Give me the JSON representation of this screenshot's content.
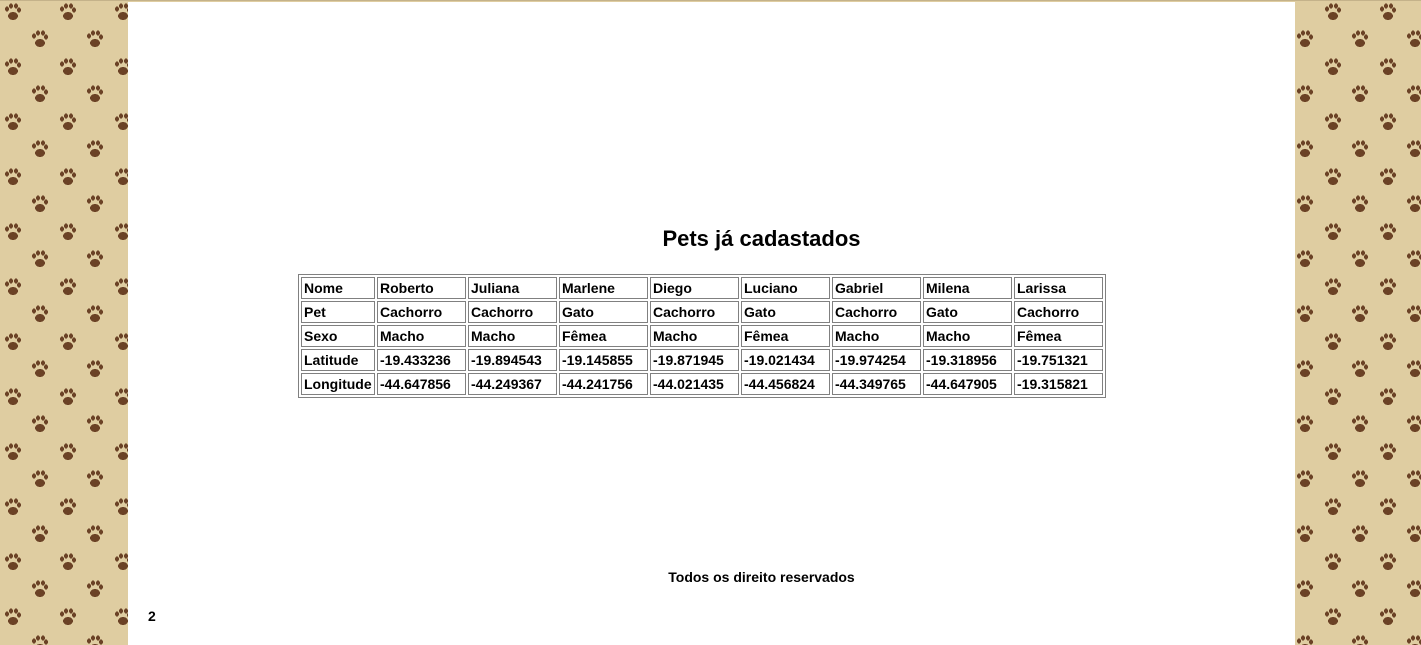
{
  "page": {
    "title": "Pets já cadastados",
    "footer": "Todos os direito reservados",
    "page_number": "2",
    "background_color": "#dfcda1",
    "paw_color": "#6b4226"
  },
  "table": {
    "rows": [
      {
        "label": "Nome",
        "cells": [
          "Roberto",
          "Juliana",
          "Marlene",
          "Diego",
          "Luciano",
          "Gabriel",
          "Milena",
          "Larissa"
        ]
      },
      {
        "label": "Pet",
        "cells": [
          "Cachorro",
          "Cachorro",
          "Gato",
          "Cachorro",
          "Gato",
          "Cachorro",
          "Gato",
          "Cachorro"
        ]
      },
      {
        "label": "Sexo",
        "cells": [
          "Macho",
          "Macho",
          "Fêmea",
          "Macho",
          "Fêmea",
          "Macho",
          "Macho",
          "Fêmea"
        ]
      },
      {
        "label": "Latitude",
        "cells": [
          "-19.433236",
          "-19.894543",
          "-19.145855",
          "-19.871945",
          "-19.021434",
          "-19.974254",
          "-19.318956",
          "-19.751321"
        ]
      },
      {
        "label": "Longitude",
        "cells": [
          "-44.647856",
          "-44.249367",
          "-44.241756",
          "-44.021435",
          "-44.456824",
          "-44.349765",
          "-44.647905",
          "-19.315821"
        ]
      }
    ]
  }
}
